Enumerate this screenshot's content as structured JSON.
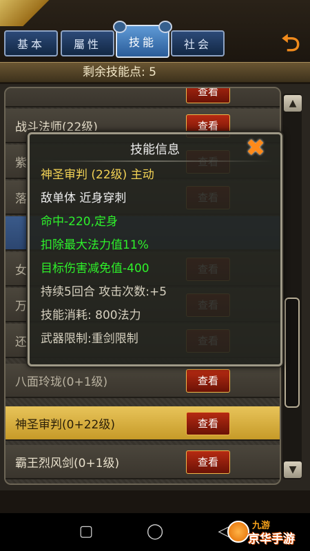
{
  "tabs": [
    {
      "label": "基本"
    },
    {
      "label": "屬性"
    },
    {
      "label": "技能"
    },
    {
      "label": "社会"
    }
  ],
  "active_tab": "技能",
  "remaining_points": {
    "label": "剩余技能点:",
    "value": "5"
  },
  "skills": [
    {
      "name": "战斗法师(22级)",
      "button": "查看"
    },
    {
      "name": "紫",
      "button": "查看"
    },
    {
      "name": "落",
      "button": "查看"
    },
    {
      "name": "女",
      "button": "查看"
    },
    {
      "name": "万",
      "button": "查看"
    },
    {
      "name": "还",
      "button": "查看"
    },
    {
      "name": "八面玲珑(0+1级)",
      "button": "查看"
    },
    {
      "name": "神圣审判(0+22级)",
      "button": "查看"
    },
    {
      "name": "霸王烈风剑(0+1级)",
      "button": "查看"
    }
  ],
  "popup": {
    "title": "技能信息",
    "close_symbol": "✖",
    "lines": [
      {
        "text": "神圣审判 (22级)   主动",
        "color": "#f2d255"
      },
      {
        "text": "敌单体   近身穿刺",
        "color": "#eeeeee"
      },
      {
        "text": "命中-220,定身",
        "color": "#2ef12a"
      },
      {
        "text": "扣除最大法力值11%",
        "color": "#2ef12a"
      },
      {
        "text": "目标伤害减免值-400",
        "color": "#2ef12a"
      },
      {
        "text": "持续5回合        攻击次数:+5",
        "color": "#d6d0bf"
      },
      {
        "text": "技能消耗: 800法力",
        "color": "#d6d0bf"
      },
      {
        "text": "武器限制:重剑限制",
        "color": "#d6d0bf"
      }
    ]
  },
  "watermark": {
    "top": "九游",
    "text": "京华手游"
  },
  "icons": {
    "back": "back-arrow-icon",
    "scroll_up": "triangle-up-icon",
    "scroll_down": "triangle-down-icon"
  }
}
